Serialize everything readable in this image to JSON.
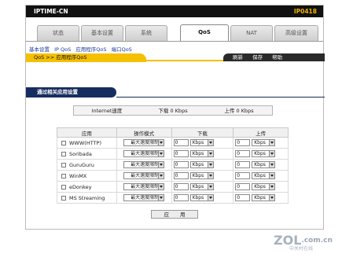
{
  "header": {
    "brand": "IPTIME-CN",
    "firmware": "IP0418"
  },
  "tabs": [
    {
      "label": "状态"
    },
    {
      "label": "基本设置"
    },
    {
      "label": "系统"
    },
    {
      "label": "QoS"
    },
    {
      "label": "NAT"
    },
    {
      "label": "高级设置"
    }
  ],
  "subnav": [
    "基本设置",
    "IP QoS",
    "应用程序QoS",
    "端口QoS"
  ],
  "breadcrumb": "QoS >> 应用程序QoS",
  "actions": {
    "refresh": "刷新",
    "save": "保存",
    "help": "帮助"
  },
  "section_title": "通过相关应用设置",
  "internet": {
    "label": "Internet速度",
    "download": "下载 0 Kbps",
    "upload": "上传 0 Kbps"
  },
  "table": {
    "headers": {
      "app": "应用",
      "mode": "操作模式",
      "download": "下载",
      "upload": "上传"
    },
    "rows": [
      {
        "app": "WWW(HTTP)",
        "mode": "最大速度限制",
        "dl": "0",
        "dl_unit": "Kbps",
        "ul": "0",
        "ul_unit": "Kbps"
      },
      {
        "app": "Soribada",
        "mode": "最大速度限制",
        "dl": "0",
        "dl_unit": "Kbps",
        "ul": "0",
        "ul_unit": "Kbps"
      },
      {
        "app": "GuruGuru",
        "mode": "最大速度限制",
        "dl": "0",
        "dl_unit": "Kbps",
        "ul": "0",
        "ul_unit": "Kbps"
      },
      {
        "app": "WinMX",
        "mode": "最大速度限制",
        "dl": "0",
        "dl_unit": "Kbps",
        "ul": "0",
        "ul_unit": "Kbps"
      },
      {
        "app": "eDonkey",
        "mode": "最大速度限制",
        "dl": "0",
        "dl_unit": "Kbps",
        "ul": "0",
        "ul_unit": "Kbps"
      },
      {
        "app": "MS Streaming",
        "mode": "最大速度限制",
        "dl": "0",
        "dl_unit": "Kbps",
        "ul": "0",
        "ul_unit": "Kbps"
      }
    ]
  },
  "apply_label": "应用",
  "watermark": {
    "logo": "ZOL",
    "domain": ".com.cn",
    "slogan": "中关村在线"
  }
}
